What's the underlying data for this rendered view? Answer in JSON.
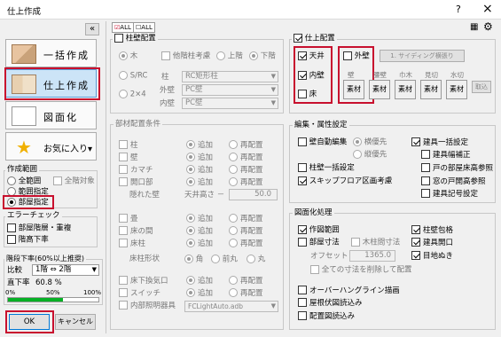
{
  "title_bar": {
    "title": "仕上作成",
    "help": "?",
    "close": "×"
  },
  "left": {
    "collapse": "«",
    "buttons": [
      {
        "label": "一括作成"
      },
      {
        "label": "仕上作成"
      },
      {
        "label": "図面化"
      },
      {
        "label": "お気に入り▾"
      }
    ],
    "sakusei_hanni": {
      "title": "作成範囲",
      "options": [
        "全範囲",
        "範囲指定",
        "部屋指定"
      ],
      "zentaisho": "全階対象"
    },
    "error_check": {
      "title": "エラーチェック",
      "items": [
        "部屋階層・重複",
        "階高下率"
      ]
    },
    "kaidan": {
      "title": "階段下率(60%以上推奨)",
      "hiritsu_label": "比較",
      "hiritsu_value": "1階 ⇔ 2階",
      "chokka_label": "直下率",
      "chokka_value": "60.8 %",
      "progress": 0.608,
      "scale": [
        "0%",
        "50%",
        "100%"
      ]
    },
    "ok": "OK",
    "cancel": "キャンセル"
  },
  "toolbar": {
    "all_on": "ALL",
    "all_off": "ALL"
  },
  "hashira": {
    "title": "柱壁配置",
    "kozo": [
      "木",
      "S/RC",
      "2×4"
    ],
    "tasei": "他階柱考慮",
    "kaikan": [
      "上階",
      "下階"
    ],
    "hashira_label": "柱",
    "hashira_value": "RC矩形柱",
    "gaiheki_label": "外壁",
    "gaiheki_value": "PC壁",
    "naiheki_label": "内壁",
    "naiheki_value": "PC壁"
  },
  "buzai": {
    "title": "部材配置条件",
    "add": "追加",
    "re": "再配置",
    "rows": [
      "柱",
      "壁",
      "カマチ",
      "開口部"
    ],
    "kakure_label": "隠れた壁",
    "tenjo_label": "天井高さ －",
    "tenjo_value": "50.0",
    "rows2": [
      "畳",
      "床の間",
      "床柱"
    ],
    "yuka_label": "床柱形状",
    "yuka_opts": [
      "角",
      "前丸",
      "丸"
    ],
    "rows3": [
      "床下換気口",
      "スイッチ",
      "内部照明器具"
    ],
    "light_value": "FCLightAuto.adb"
  },
  "shiage": {
    "title": "仕上配置",
    "items": [
      "天井",
      "内壁",
      "床"
    ],
    "gaiheki": "外壁",
    "siding": "1. サイディング横張り",
    "columns": [
      "壁",
      "腰壁",
      "巾木",
      "見切",
      "水切"
    ],
    "sozai": "素材",
    "kaijo": "取込"
  },
  "henshu": {
    "title": "編集・属性設定",
    "kabe_auto": "壁自動編集",
    "yoko": "横優先",
    "tate": "縦優先",
    "hashira_kabe": "柱壁一括設定",
    "skip": "スキップフロア区画考慮",
    "right": [
      "建具一括設定",
      "建具幅補正",
      "戸の部屋床高参照",
      "窓の戸開高参照",
      "建具記号設定"
    ]
  },
  "zumen": {
    "title": "図面化処理",
    "sakuzu": "作図範囲",
    "heya_sunpo": "部屋寸法",
    "mokuzai": "木柱間寸法",
    "offset_label": "オフセット",
    "offset_value": "1365.0",
    "zen": "全ての寸法を削除して配置",
    "right": [
      "柱壁包格",
      "建具開口",
      "目地ぬき"
    ],
    "more": [
      "オーバーハングライン描画",
      "屋根伏図読込み",
      "配置図読込み"
    ]
  },
  "colors": {
    "highlight": "#c8102e"
  }
}
